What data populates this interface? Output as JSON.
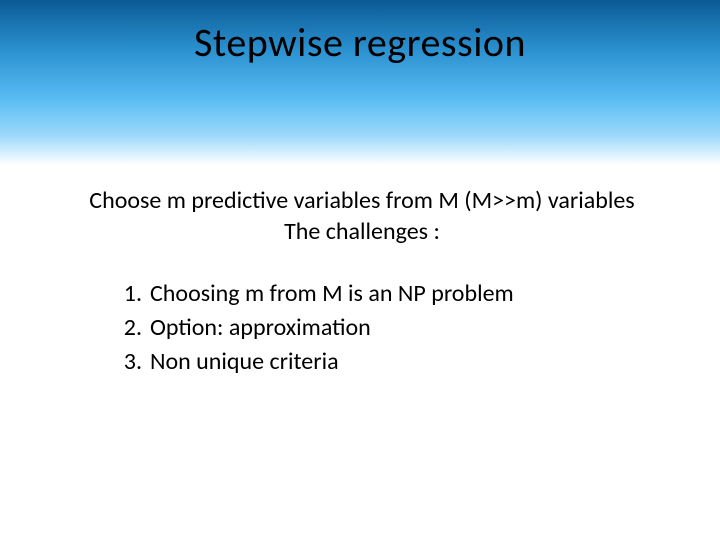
{
  "slide": {
    "title": "Stepwise regression",
    "intro_line1": "Choose m predictive variables from M (M>>m) variables",
    "intro_line2": "The challenges :",
    "items": [
      "Choosing m from M is an NP problem",
      "Option: approximation",
      "Non unique criteria"
    ]
  }
}
